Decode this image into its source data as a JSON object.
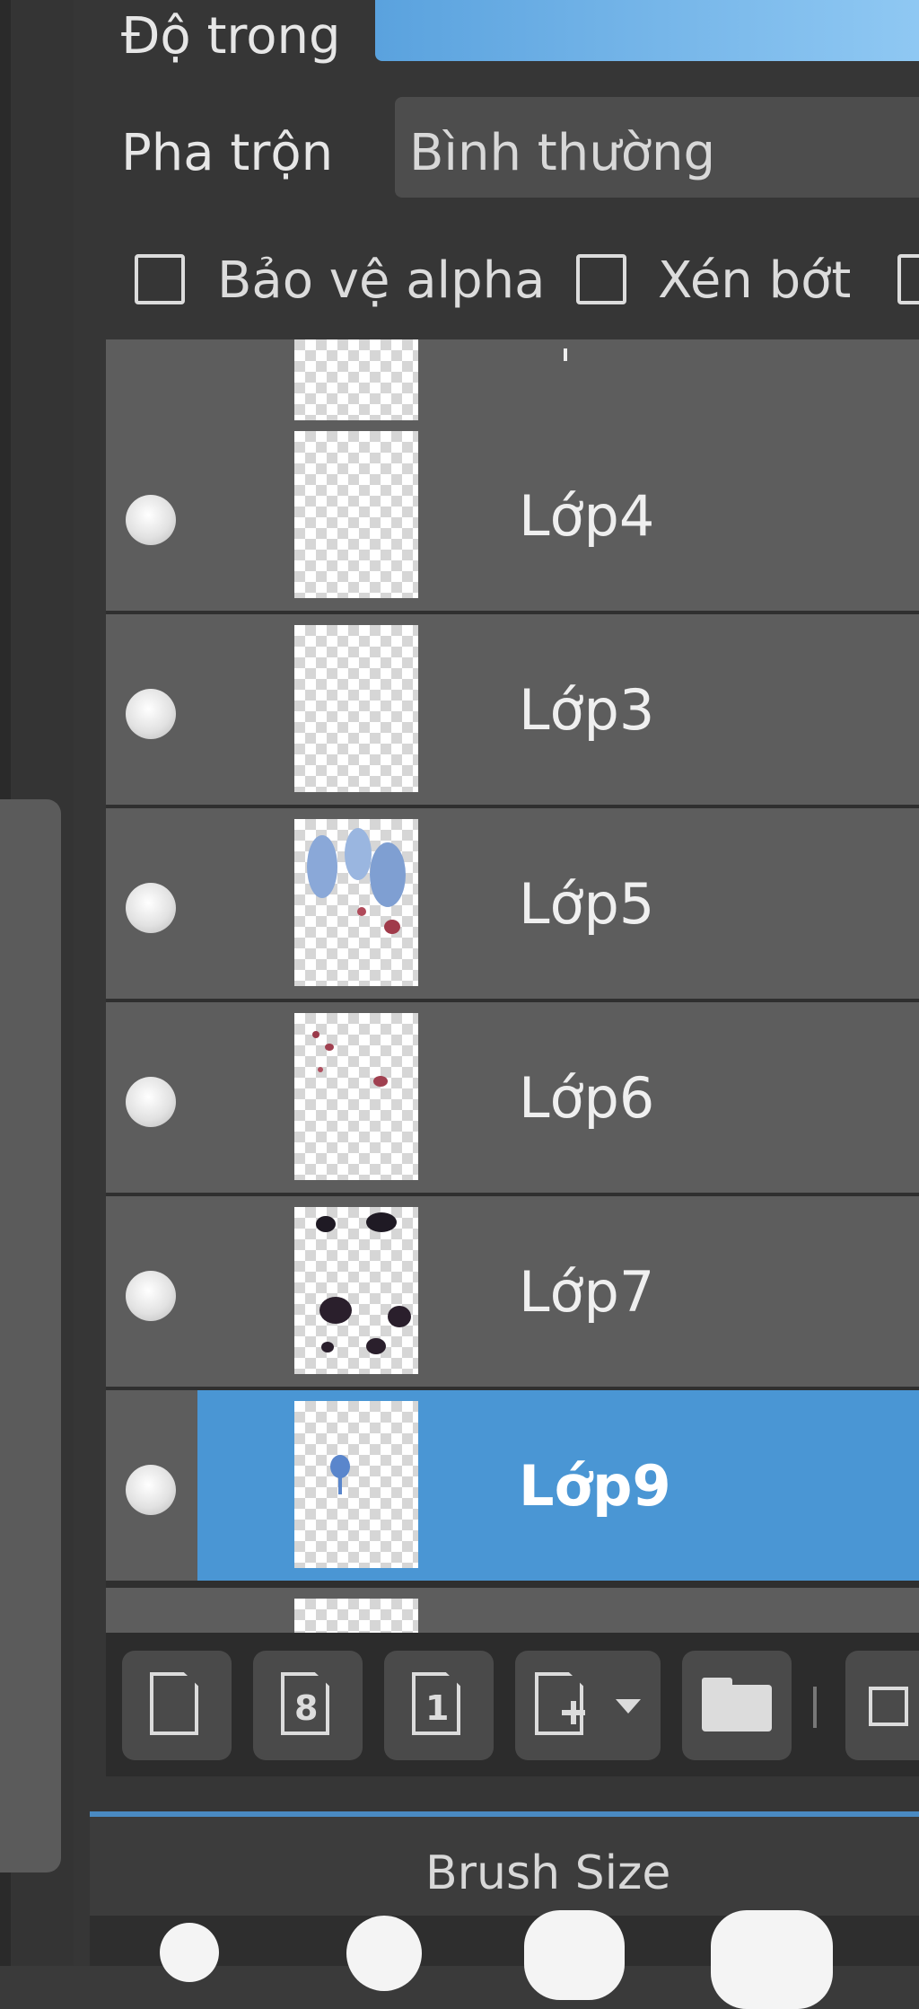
{
  "opacity": {
    "label": "Độ trong"
  },
  "blend": {
    "label": "Pha trộn",
    "value": "Bình thường"
  },
  "checkboxes": {
    "alpha_protect": {
      "label": "Bảo vệ alpha",
      "checked": false
    },
    "clipping": {
      "label": "Xén bớt",
      "checked": false
    }
  },
  "layers": [
    {
      "name": "Lớp4",
      "visible": true,
      "selected": false
    },
    {
      "name": "Lớp3",
      "visible": true,
      "selected": false
    },
    {
      "name": "Lớp5",
      "visible": true,
      "selected": false
    },
    {
      "name": "Lớp6",
      "visible": true,
      "selected": false
    },
    {
      "name": "Lớp7",
      "visible": true,
      "selected": false
    },
    {
      "name": "Lớp9",
      "visible": true,
      "selected": true
    }
  ],
  "toolbar": {
    "buttons": [
      {
        "icon": "new-layer-icon"
      },
      {
        "icon": "new-8bit-layer-icon",
        "glyph": "8"
      },
      {
        "icon": "new-1bit-layer-icon",
        "glyph": "1"
      },
      {
        "icon": "add-layer-dropdown-icon"
      },
      {
        "icon": "folder-icon"
      },
      {
        "icon": "duplicate-layer-icon"
      }
    ]
  },
  "brush": {
    "title": "Brush Size"
  },
  "colors": {
    "selected": "#4a96d4",
    "row": "#5d5d5d",
    "accent": "#5aa2de"
  }
}
